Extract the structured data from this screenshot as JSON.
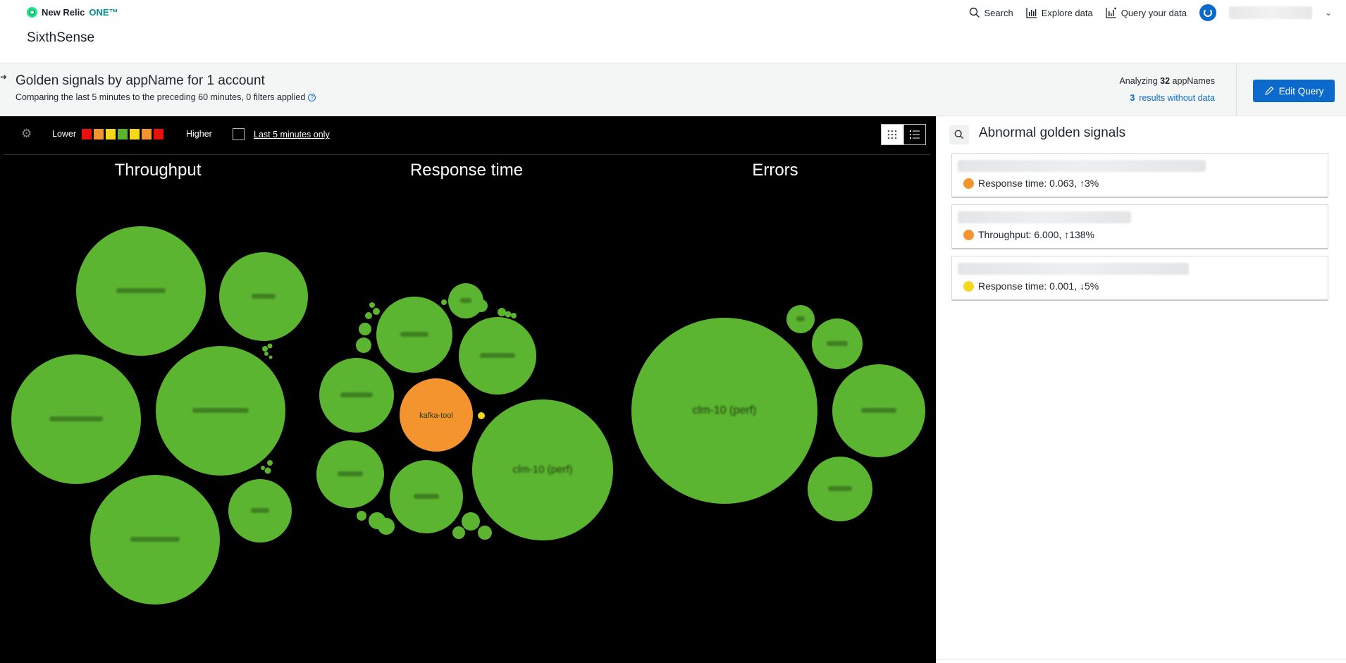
{
  "nav": {
    "brand": "New Relic",
    "brand_suffix": "ONE™",
    "app_title": "SixthSense",
    "search_label": "Search",
    "explore_label": "Explore data",
    "query_label": "Query your data"
  },
  "header": {
    "title": "Golden signals by appName for 1 account",
    "subtitle": "Comparing the last 5 minutes to the preceding 60 minutes, 0 filters applied",
    "analyzing_prefix": "Analyzing",
    "analyzing_count": "32",
    "analyzing_suffix": "appNames",
    "no_data_count": "3",
    "no_data_label": "results without data",
    "edit_button": "Edit Query"
  },
  "toolbar": {
    "lower_label": "Lower",
    "higher_label": "Higher",
    "scale_colors": [
      "#e8120c",
      "#f4942f",
      "#f4d81c",
      "#5cb531",
      "#f4d81c",
      "#f4942f",
      "#e8120c"
    ],
    "last5_label": "Last 5 minutes only"
  },
  "columns": {
    "throughput": "Throughput",
    "response": "Response time",
    "errors": "Errors"
  },
  "colors": {
    "healthy": "#5cb531",
    "warning": "#f4942f",
    "minor": "#f4d81c",
    "accent": "#0b6acb"
  },
  "bubble_labels": {
    "kafka_tool": "kafka-tool",
    "perf": "clm-10 (perf)"
  },
  "panel": {
    "title": "Abnormal golden signals",
    "cards": [
      {
        "signal": "Response time: 0.063, ↑3%",
        "color": "#f4942f"
      },
      {
        "signal": "Throughput: 6.000, ↑138%",
        "color": "#f4942f"
      },
      {
        "signal": "Response time: 0.001, ↓5%",
        "color": "#f4d81c"
      }
    ]
  }
}
